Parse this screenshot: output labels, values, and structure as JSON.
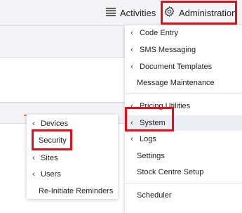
{
  "header": {
    "activities_label": "Activities",
    "administration_label": "Administration"
  },
  "admin_menu": {
    "items": [
      {
        "label": "Code Entry",
        "has_submenu": true
      },
      {
        "label": "SMS Messaging",
        "has_submenu": true
      },
      {
        "label": "Document Templates",
        "has_submenu": true
      },
      {
        "label": "Message Maintenance",
        "has_submenu": false
      },
      {
        "label": "Pricing Utilities",
        "has_submenu": true
      },
      {
        "label": "System",
        "has_submenu": true,
        "active": true
      },
      {
        "label": "Logs",
        "has_submenu": true
      },
      {
        "label": "Settings",
        "has_submenu": false
      },
      {
        "label": "Stock Centre Setup",
        "has_submenu": false
      },
      {
        "label": "Scheduler",
        "has_submenu": false
      }
    ]
  },
  "system_menu": {
    "items": [
      {
        "label": "Devices",
        "has_submenu": true
      },
      {
        "label": "Security",
        "has_submenu": false
      },
      {
        "label": "Sites",
        "has_submenu": true
      },
      {
        "label": "Users",
        "has_submenu": true
      },
      {
        "label": "Re-Initiate Reminders",
        "has_submenu": false
      }
    ]
  },
  "colors": {
    "highlight": "#e0101a",
    "active_row": "#ececf4",
    "accent": "#e8843c"
  }
}
